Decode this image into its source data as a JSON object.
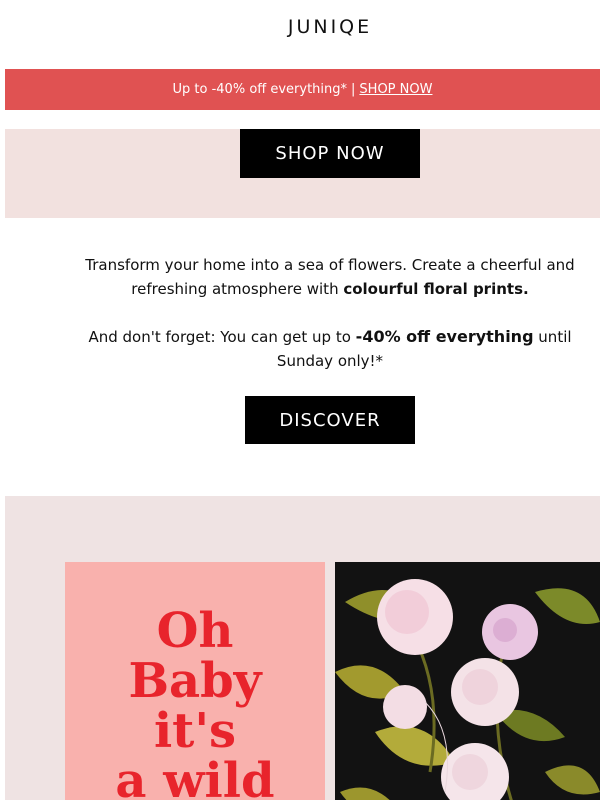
{
  "header": {
    "logo_text": "JUNIQE"
  },
  "promo": {
    "text": "Up to -40% off everything*",
    "separator": "|",
    "link_label": "SHOP NOW"
  },
  "hero": {
    "button_label": "SHOP NOW"
  },
  "body": {
    "line1_a": "Transform your home into a sea of flowers. Create a cheerful and refreshing atmosphere with ",
    "line1_bold": "colourful floral prints.",
    "line2_a": "And don't forget: You can get up to ",
    "line2_bold": "-40% off everything",
    "line2_b": " until Sunday only!*",
    "discover_label": "DISCOVER"
  },
  "feature": {
    "left_print_lines": [
      "Oh",
      "Baby",
      "it's",
      "a wild"
    ]
  },
  "colors": {
    "promo_bg": "#e05252",
    "hero_bg": "#f2e1df",
    "feature_bg": "#efe3e3",
    "print_pink": "#f9b1ad",
    "print_text": "#e8242c"
  }
}
